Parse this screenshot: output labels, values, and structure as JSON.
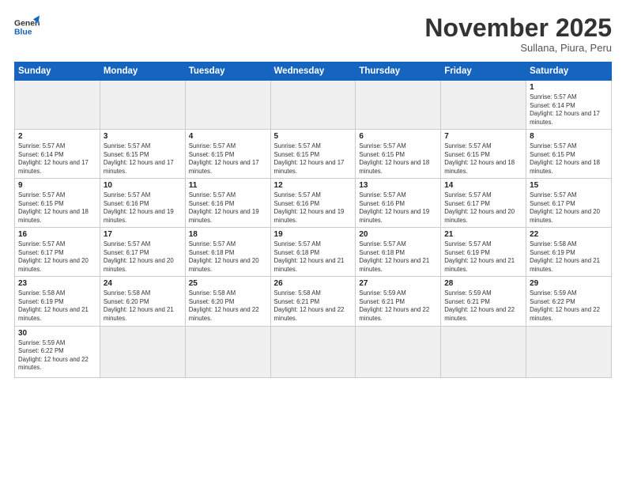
{
  "logo": {
    "general": "General",
    "blue": "Blue"
  },
  "header": {
    "month": "November 2025",
    "location": "Sullana, Piura, Peru"
  },
  "weekdays": [
    "Sunday",
    "Monday",
    "Tuesday",
    "Wednesday",
    "Thursday",
    "Friday",
    "Saturday"
  ],
  "weeks": [
    [
      {
        "day": "",
        "empty": true
      },
      {
        "day": "",
        "empty": true
      },
      {
        "day": "",
        "empty": true
      },
      {
        "day": "",
        "empty": true
      },
      {
        "day": "",
        "empty": true
      },
      {
        "day": "",
        "empty": true
      },
      {
        "day": "1",
        "sunrise": "Sunrise: 5:57 AM",
        "sunset": "Sunset: 6:14 PM",
        "daylight": "Daylight: 12 hours and 17 minutes."
      }
    ],
    [
      {
        "day": "2",
        "sunrise": "Sunrise: 5:57 AM",
        "sunset": "Sunset: 6:14 PM",
        "daylight": "Daylight: 12 hours and 17 minutes."
      },
      {
        "day": "3",
        "sunrise": "Sunrise: 5:57 AM",
        "sunset": "Sunset: 6:15 PM",
        "daylight": "Daylight: 12 hours and 17 minutes."
      },
      {
        "day": "4",
        "sunrise": "Sunrise: 5:57 AM",
        "sunset": "Sunset: 6:15 PM",
        "daylight": "Daylight: 12 hours and 17 minutes."
      },
      {
        "day": "5",
        "sunrise": "Sunrise: 5:57 AM",
        "sunset": "Sunset: 6:15 PM",
        "daylight": "Daylight: 12 hours and 17 minutes."
      },
      {
        "day": "6",
        "sunrise": "Sunrise: 5:57 AM",
        "sunset": "Sunset: 6:15 PM",
        "daylight": "Daylight: 12 hours and 18 minutes."
      },
      {
        "day": "7",
        "sunrise": "Sunrise: 5:57 AM",
        "sunset": "Sunset: 6:15 PM",
        "daylight": "Daylight: 12 hours and 18 minutes."
      },
      {
        "day": "8",
        "sunrise": "Sunrise: 5:57 AM",
        "sunset": "Sunset: 6:15 PM",
        "daylight": "Daylight: 12 hours and 18 minutes."
      }
    ],
    [
      {
        "day": "9",
        "sunrise": "Sunrise: 5:57 AM",
        "sunset": "Sunset: 6:15 PM",
        "daylight": "Daylight: 12 hours and 18 minutes."
      },
      {
        "day": "10",
        "sunrise": "Sunrise: 5:57 AM",
        "sunset": "Sunset: 6:16 PM",
        "daylight": "Daylight: 12 hours and 19 minutes."
      },
      {
        "day": "11",
        "sunrise": "Sunrise: 5:57 AM",
        "sunset": "Sunset: 6:16 PM",
        "daylight": "Daylight: 12 hours and 19 minutes."
      },
      {
        "day": "12",
        "sunrise": "Sunrise: 5:57 AM",
        "sunset": "Sunset: 6:16 PM",
        "daylight": "Daylight: 12 hours and 19 minutes."
      },
      {
        "day": "13",
        "sunrise": "Sunrise: 5:57 AM",
        "sunset": "Sunset: 6:16 PM",
        "daylight": "Daylight: 12 hours and 19 minutes."
      },
      {
        "day": "14",
        "sunrise": "Sunrise: 5:57 AM",
        "sunset": "Sunset: 6:17 PM",
        "daylight": "Daylight: 12 hours and 20 minutes."
      },
      {
        "day": "15",
        "sunrise": "Sunrise: 5:57 AM",
        "sunset": "Sunset: 6:17 PM",
        "daylight": "Daylight: 12 hours and 20 minutes."
      }
    ],
    [
      {
        "day": "16",
        "sunrise": "Sunrise: 5:57 AM",
        "sunset": "Sunset: 6:17 PM",
        "daylight": "Daylight: 12 hours and 20 minutes."
      },
      {
        "day": "17",
        "sunrise": "Sunrise: 5:57 AM",
        "sunset": "Sunset: 6:17 PM",
        "daylight": "Daylight: 12 hours and 20 minutes."
      },
      {
        "day": "18",
        "sunrise": "Sunrise: 5:57 AM",
        "sunset": "Sunset: 6:18 PM",
        "daylight": "Daylight: 12 hours and 20 minutes."
      },
      {
        "day": "19",
        "sunrise": "Sunrise: 5:57 AM",
        "sunset": "Sunset: 6:18 PM",
        "daylight": "Daylight: 12 hours and 21 minutes."
      },
      {
        "day": "20",
        "sunrise": "Sunrise: 5:57 AM",
        "sunset": "Sunset: 6:18 PM",
        "daylight": "Daylight: 12 hours and 21 minutes."
      },
      {
        "day": "21",
        "sunrise": "Sunrise: 5:57 AM",
        "sunset": "Sunset: 6:19 PM",
        "daylight": "Daylight: 12 hours and 21 minutes."
      },
      {
        "day": "22",
        "sunrise": "Sunrise: 5:58 AM",
        "sunset": "Sunset: 6:19 PM",
        "daylight": "Daylight: 12 hours and 21 minutes."
      }
    ],
    [
      {
        "day": "23",
        "sunrise": "Sunrise: 5:58 AM",
        "sunset": "Sunset: 6:19 PM",
        "daylight": "Daylight: 12 hours and 21 minutes."
      },
      {
        "day": "24",
        "sunrise": "Sunrise: 5:58 AM",
        "sunset": "Sunset: 6:20 PM",
        "daylight": "Daylight: 12 hours and 21 minutes."
      },
      {
        "day": "25",
        "sunrise": "Sunrise: 5:58 AM",
        "sunset": "Sunset: 6:20 PM",
        "daylight": "Daylight: 12 hours and 22 minutes."
      },
      {
        "day": "26",
        "sunrise": "Sunrise: 5:58 AM",
        "sunset": "Sunset: 6:21 PM",
        "daylight": "Daylight: 12 hours and 22 minutes."
      },
      {
        "day": "27",
        "sunrise": "Sunrise: 5:59 AM",
        "sunset": "Sunset: 6:21 PM",
        "daylight": "Daylight: 12 hours and 22 minutes."
      },
      {
        "day": "28",
        "sunrise": "Sunrise: 5:59 AM",
        "sunset": "Sunset: 6:21 PM",
        "daylight": "Daylight: 12 hours and 22 minutes."
      },
      {
        "day": "29",
        "sunrise": "Sunrise: 5:59 AM",
        "sunset": "Sunset: 6:22 PM",
        "daylight": "Daylight: 12 hours and 22 minutes."
      }
    ],
    [
      {
        "day": "30",
        "sunrise": "Sunrise: 5:59 AM",
        "sunset": "Sunset: 6:22 PM",
        "daylight": "Daylight: 12 hours and 22 minutes."
      },
      {
        "day": "",
        "empty": true
      },
      {
        "day": "",
        "empty": true
      },
      {
        "day": "",
        "empty": true
      },
      {
        "day": "",
        "empty": true
      },
      {
        "day": "",
        "empty": true
      },
      {
        "day": "",
        "empty": true
      }
    ]
  ]
}
